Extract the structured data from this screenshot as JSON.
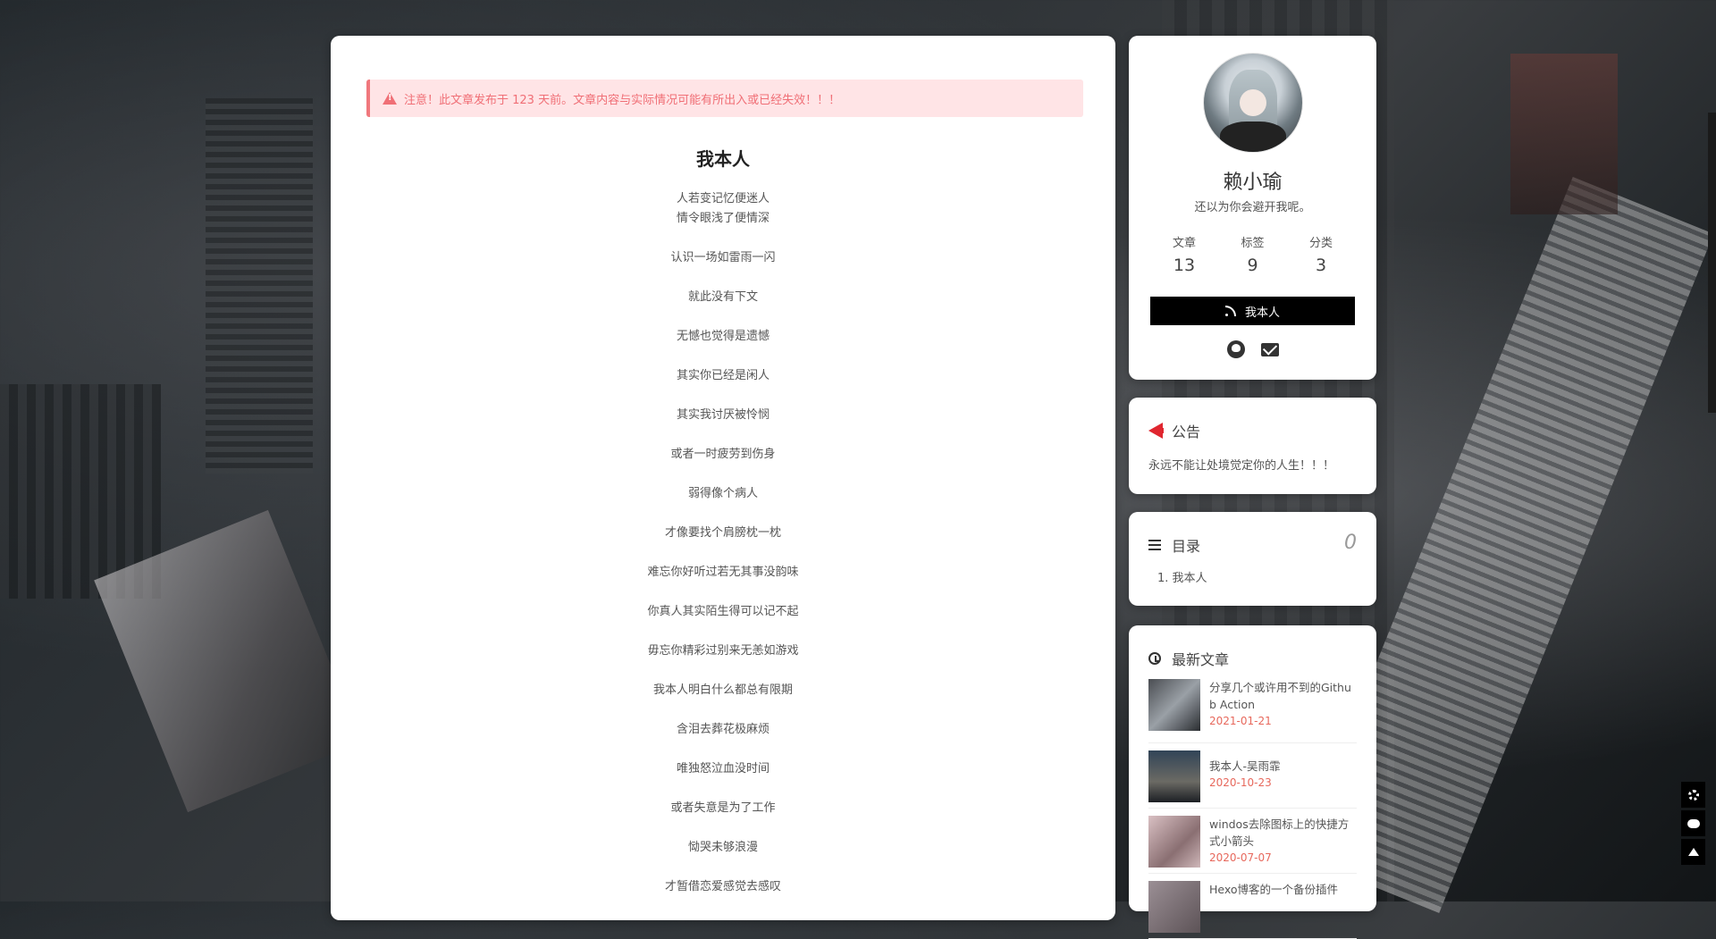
{
  "notice_banner": "注意！此文章发布于 123 天前。文章内容与实际情况可能有所出入或已经失效！！！",
  "post": {
    "title": "我本人",
    "lines": [
      [
        "人若变记忆便迷人",
        "情令眼浅了便情深"
      ],
      [
        "认识一场如雷雨一闪"
      ],
      [
        "就此没有下文"
      ],
      [
        "无憾也觉得是遗憾"
      ],
      [
        "其实你已经是闲人"
      ],
      [
        "其实我讨厌被怜悯"
      ],
      [
        "或者一时疲劳到伤身"
      ],
      [
        "弱得像个病人"
      ],
      [
        "才像要找个肩膀枕一枕"
      ],
      [
        "难忘你好听过若无其事没韵味"
      ],
      [
        "你真人其实陌生得可以记不起"
      ],
      [
        "毋忘你精彩过别来无恙如游戏"
      ],
      [
        "我本人明白什么都总有限期"
      ],
      [
        "含泪去葬花极麻烦"
      ],
      [
        "唯独怒泣血没时间"
      ],
      [
        "或者失意是为了工作"
      ],
      [
        "恸哭未够浪漫"
      ],
      [
        "才暂借恋爱感觉去感叹"
      ]
    ]
  },
  "profile": {
    "name": "赖小瑜",
    "motto": "还以为你会避开我呢。",
    "stats": [
      {
        "label": "文章",
        "value": "13"
      },
      {
        "label": "标签",
        "value": "9"
      },
      {
        "label": "分类",
        "value": "3"
      }
    ],
    "follow_label": "我本人",
    "social_icons": [
      "github-icon",
      "envelope-icon"
    ]
  },
  "announcement": {
    "title": "公告",
    "text": "永远不能让处境觉定你的人生！！！",
    "icon": "bullhorn-icon",
    "icon_color": "#e0262f"
  },
  "toc": {
    "title": "目录",
    "count": "0",
    "items": [
      "1. 我本人"
    ]
  },
  "recent": {
    "title": "最新文章",
    "items": [
      {
        "title": "分享几个或许用不到的Github Action",
        "date": "2021-01-21"
      },
      {
        "title": "我本人-吴雨霏",
        "date": "2020-10-23"
      },
      {
        "title": "windos去除图标上的快捷方式小箭头",
        "date": "2020-07-07"
      },
      {
        "title": "Hexo博客的一个备份插件",
        "date": ""
      }
    ]
  },
  "tools": [
    "gear-icon",
    "comments-icon",
    "arrow-up-icon"
  ],
  "colors": {
    "date": "#e7685c",
    "notice_text": "#f06f76",
    "notice_bg": "#ffe4e6"
  }
}
